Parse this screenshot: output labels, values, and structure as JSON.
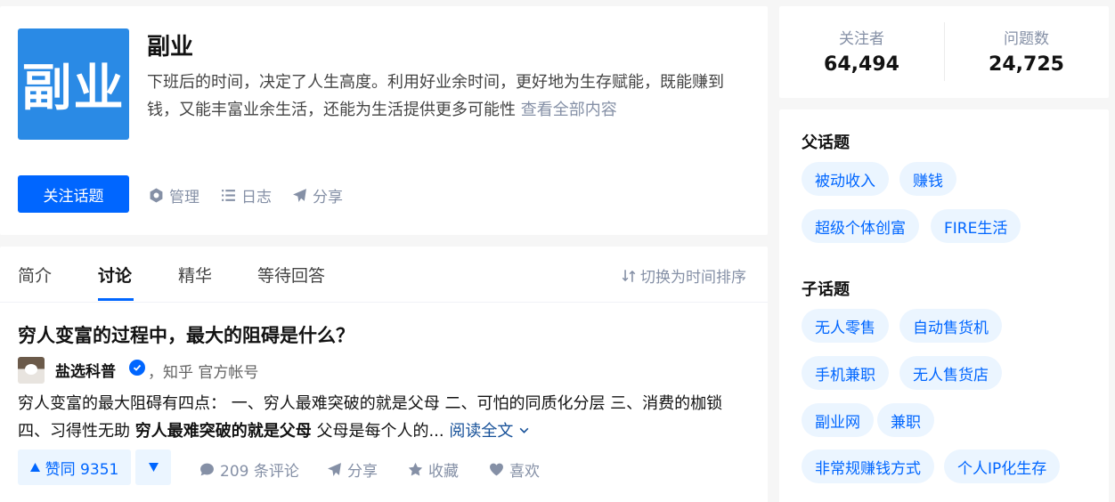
{
  "topic": {
    "logo_text": "副业",
    "title": "副业",
    "description": "下班后的时间，决定了人生高度。利用好业余时间，更好地为生存赋能，既能赚到钱，又能丰富业余生活，还能为生活提供更多可能性",
    "view_all": "查看全部内容",
    "follow_label": "关注话题",
    "actions": {
      "manage": "管理",
      "log": "日志",
      "share": "分享"
    }
  },
  "stats": {
    "followers_label": "关注者",
    "followers_value": "64,494",
    "questions_label": "问题数",
    "questions_value": "24,725"
  },
  "parent_topics": {
    "title": "父话题",
    "items": [
      "被动收入",
      "赚钱",
      "超级个体创富",
      "FIRE生活"
    ]
  },
  "child_topics": {
    "title": "子话题",
    "items": [
      "无人零售",
      "自动售货机",
      "手机兼职",
      "无人售货店",
      "副业网",
      "兼职",
      "非常规赚钱方式",
      "个人IP化生存"
    ]
  },
  "tabs": [
    "简介",
    "讨论",
    "精华",
    "等待回答"
  ],
  "active_tab": "讨论",
  "sort_toggle": "切换为时间排序",
  "feed": {
    "question_title": "穷人变富的过程中，最大的阻碍是什么？",
    "author_name": "盐选科普",
    "author_meta": "，知乎 官方帐号",
    "excerpt_plain": "穷人变富的最大阻碍有四点： 一、穷人最难突破的就是父母 二、可怕的同质化分层 三、消费的枷锁 四、习得性无助 ",
    "excerpt_bold": "穷人最难突破的就是父母",
    "excerpt_tail": " 父母是每个人的...",
    "read_more": "阅读全文",
    "vote_up_label": "赞同 9351",
    "comments": "209 条评论",
    "share": "分享",
    "favorite": "收藏",
    "like": "喜欢"
  },
  "colors": {
    "brand_blue": "#0066ff",
    "logo_blue": "#2a8ae5",
    "tag_bg": "#ebf5ff",
    "muted": "#8590a6"
  }
}
